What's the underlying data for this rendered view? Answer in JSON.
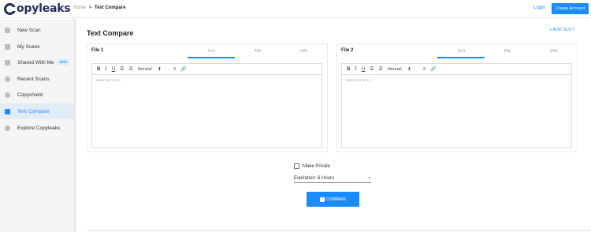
{
  "app": {
    "logo_text": "opyleaks"
  },
  "breadcrumb": {
    "home": "Home",
    "separator": ">",
    "current": "Text Compare"
  },
  "header": {
    "login": "Login",
    "create_account": "Create Account"
  },
  "sidebar": {
    "items": [
      {
        "label": "New Scan",
        "icon": "document-icon"
      },
      {
        "label": "My Scans",
        "icon": "folder-icon"
      },
      {
        "label": "Shared With Me",
        "icon": "shared-folder-icon",
        "badge": "beta"
      },
      {
        "label": "Recent Scans",
        "icon": "clock-icon"
      },
      {
        "label": "Copyshield",
        "icon": "shield-icon"
      },
      {
        "label": "Text Compare",
        "icon": "compare-icon",
        "active": true
      },
      {
        "label": "Explore Copyleaks",
        "icon": "compass-icon"
      }
    ]
  },
  "main": {
    "title": "Text Compare",
    "add_slot": "+ ADD SLOT",
    "panels": [
      {
        "title": "File 1",
        "tabs": [
          "Text",
          "File",
          "URL"
        ],
        "active_tab": "Text",
        "placeholder": "Enter text here..."
      },
      {
        "title": "File 2",
        "tabs": [
          "Text",
          "File",
          "URL"
        ],
        "active_tab": "Text",
        "placeholder": "Enter text here..."
      }
    ],
    "toolbar": {
      "bold": "B",
      "italic": "I",
      "underline": "U",
      "ordered_list": "☰",
      "bullet_list": "☰",
      "style_select": "Normal",
      "select_caret": "⬍",
      "align": "≡",
      "link": "🔗"
    },
    "make_private": "Make Private",
    "expiration": {
      "label": "Expiration: 6 Hours",
      "caret": "▼"
    },
    "compare_button": "COMPARE"
  },
  "colors": {
    "accent": "#1a8cff",
    "logo": "#1f2d5c",
    "sidebar_bg": "#f5f5f5",
    "sidebar_active_bg": "#e1ecf6"
  }
}
